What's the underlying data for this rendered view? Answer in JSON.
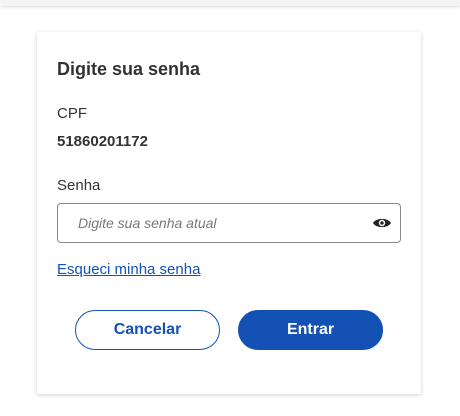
{
  "form": {
    "title": "Digite sua senha",
    "cpf_label": "CPF",
    "cpf_value": "51860201172",
    "password_label": "Senha",
    "password_placeholder": "Digite sua senha atual",
    "password_value": "",
    "show_password_icon": "eye-icon",
    "forgot_link": "Esqueci minha senha",
    "cancel_label": "Cancelar",
    "enter_label": "Entrar"
  },
  "colors": {
    "primary": "#1351b4",
    "text": "#333333"
  }
}
